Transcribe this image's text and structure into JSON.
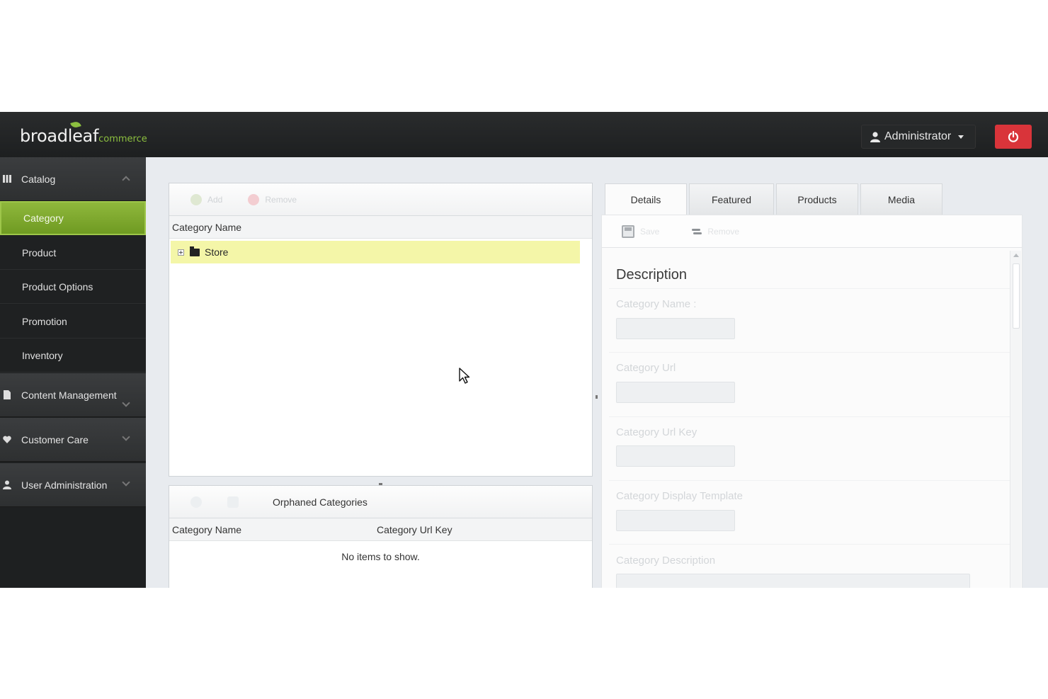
{
  "header": {
    "logo_main": "broadleaf",
    "logo_sub": "commerce",
    "user_label": "Administrator"
  },
  "sidebar": {
    "sections": [
      {
        "label": "Catalog",
        "expanded": true
      },
      {
        "label": "Content Management",
        "expanded": false
      },
      {
        "label": "Customer Care",
        "expanded": false
      },
      {
        "label": "User Administration",
        "expanded": false
      }
    ],
    "catalog_items": [
      "Category",
      "Product",
      "Product Options",
      "Promotion",
      "Inventory"
    ],
    "active_item": "Category",
    "accent_color": "#8fb83c"
  },
  "tree_panel": {
    "toolbar": {
      "add_label": "Add",
      "remove_label": "Remove"
    },
    "column_header": "Category Name",
    "rows": [
      {
        "label": "Store",
        "selected": true
      }
    ]
  },
  "orphan_panel": {
    "title": "Orphaned Categories",
    "columns": [
      "Category Name",
      "Category Url Key"
    ],
    "empty_message": "No items to show."
  },
  "detail_panel": {
    "tabs": [
      "Details",
      "Featured",
      "Products",
      "Media"
    ],
    "active_tab": "Details",
    "toolbar": {
      "save_label": "Save",
      "remove_label": "Remove"
    },
    "section_title": "Description",
    "fields": [
      {
        "label": "Category Name :",
        "value": ""
      },
      {
        "label": "Category Url",
        "value": ""
      },
      {
        "label": "Category Url Key",
        "value": ""
      },
      {
        "label": "Category Display Template",
        "value": ""
      },
      {
        "label": "Category Description",
        "value": ""
      }
    ]
  },
  "colors": {
    "header_bg": "#1d1f20",
    "logout_red": "#d9343a",
    "selection_yellow": "#f4f6a8"
  }
}
